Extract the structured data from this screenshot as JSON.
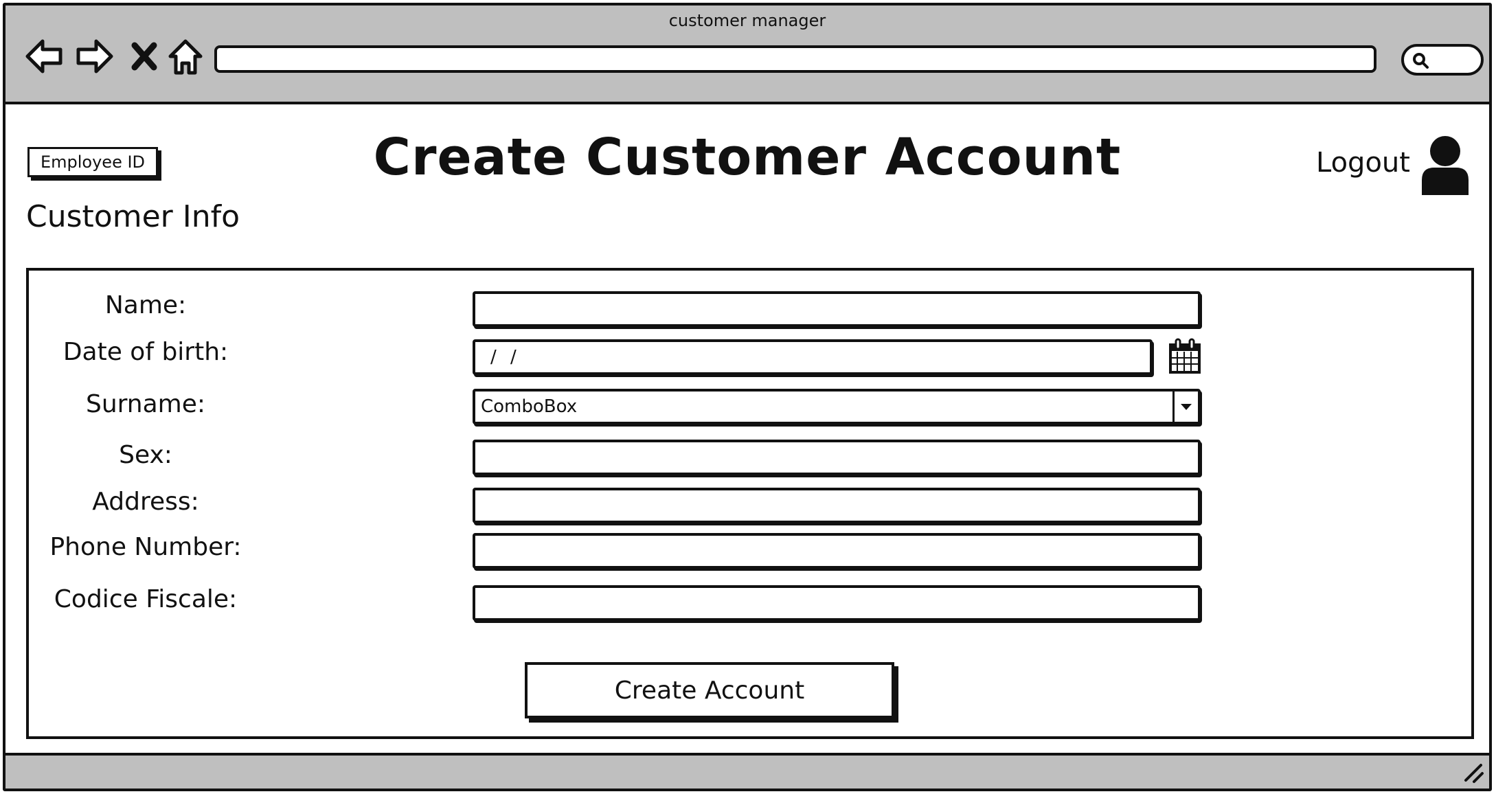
{
  "window": {
    "title": "customer manager"
  },
  "browser": {
    "icons": [
      "back-icon",
      "forward-icon",
      "close-icon",
      "home-icon",
      "search-icon"
    ],
    "address_value": "",
    "search_value": ""
  },
  "header": {
    "employee_id_label": "Employee ID",
    "page_title": "Create Customer Account",
    "logout_label": "Logout"
  },
  "section": {
    "title": "Customer Info"
  },
  "form": {
    "name_label": "Name:",
    "dob_label": "Date of birth:",
    "dob_value": "/ /",
    "surname_label": "Surname:",
    "surname_value": "ComboBox",
    "sex_label": "Sex:",
    "address_label": "Address:",
    "phone_label": "Phone Number:",
    "codice_label": "Codice Fiscale:",
    "submit_label": "Create Account"
  }
}
